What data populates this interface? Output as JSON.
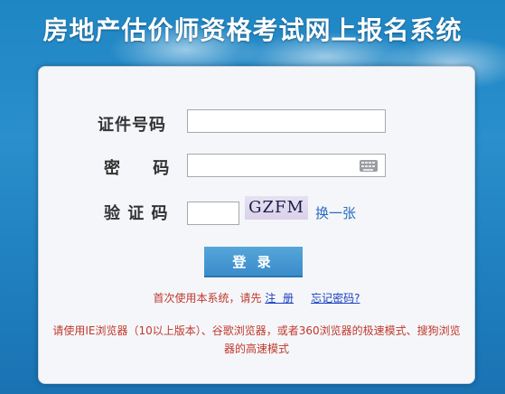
{
  "header": {
    "title": "房地产估价师资格考试网上报名系统"
  },
  "form": {
    "id_label": "证件号码",
    "password_label": "密　 码",
    "captcha_label": "验 证 码",
    "captcha_text": "GZFM",
    "refresh_label": "换一张",
    "login_label": "登 录"
  },
  "hints": {
    "first_visit": "首次使用本系统，请先",
    "register": "注  册",
    "forgot": "忘记密码?",
    "browser": "请使用IE浏览器（10以上版本）、谷歌浏览器，或者360浏览器的极速模式、搜狗浏览器的高速模式"
  },
  "colors": {
    "background": "#1f86c4",
    "button": "#3a8ccb",
    "warning_text": "#c0392b",
    "link": "#1a3fbf"
  }
}
